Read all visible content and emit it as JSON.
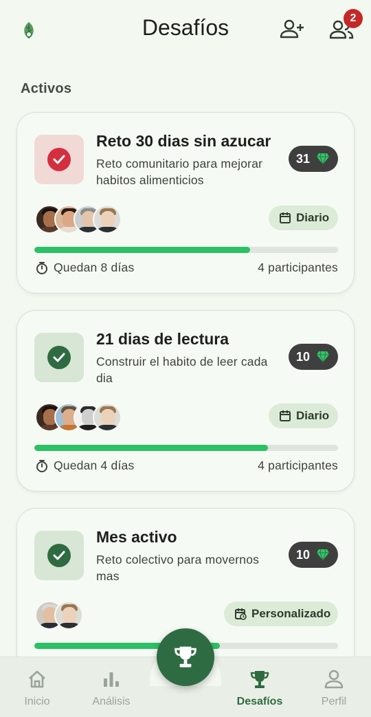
{
  "header": {
    "title": "Desafíos",
    "notifications_count": "2"
  },
  "section": {
    "title": "Activos"
  },
  "challenges": [
    {
      "title": "Reto 30 dias sin azucar",
      "description": "Reto comunitario para mejorar habitos alimenticios",
      "gems": "31",
      "frequency": "Diario",
      "remaining": "Quedan 8 días",
      "participants": "4 participantes",
      "progress": 0.71,
      "status_color": "#d32f3f"
    },
    {
      "title": "21 dias de lectura",
      "description": "Construir el habito de leer cada dia",
      "gems": "10",
      "frequency": "Diario",
      "remaining": "Quedan 4 días",
      "participants": "4 participantes",
      "progress": 0.77,
      "status_color": "#2f6b42"
    },
    {
      "title": "Mes activo",
      "description": "Reto colectivo para movernos mas",
      "gems": "10",
      "frequency": "Personalizado",
      "progress": 0.61,
      "status_color": "#2f6b42"
    }
  ],
  "nav": {
    "home": "Inicio",
    "analysis": "Análisis",
    "challenges": "Desafíos",
    "profile": "Perfil"
  },
  "colors": {
    "accent": "#2f6b42",
    "progress": "#2bc164",
    "gem": "#35c46a",
    "alert": "#c62828"
  },
  "icons": [
    "leaf-logo-icon",
    "add-friend-icon",
    "friends-icon",
    "check-icon",
    "gem-icon",
    "calendar-icon",
    "calendar-sync-icon",
    "stopwatch-icon",
    "home-icon",
    "bar-chart-icon",
    "trophy-icon",
    "person-icon"
  ]
}
